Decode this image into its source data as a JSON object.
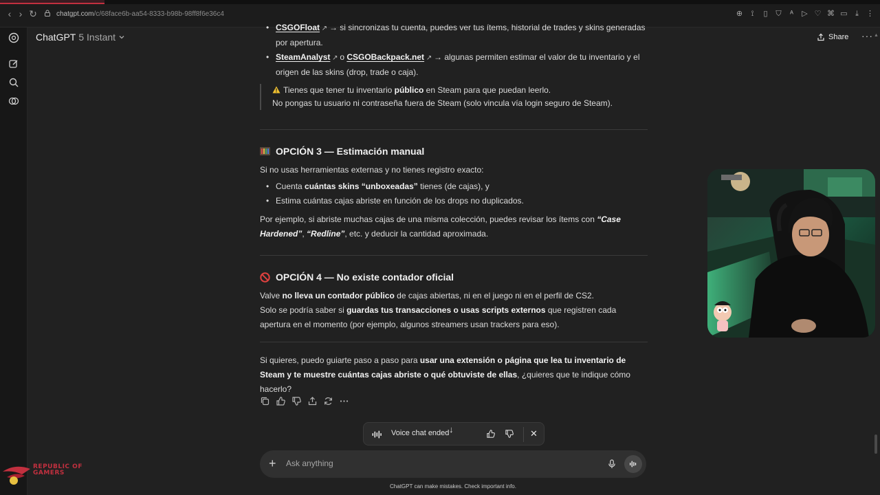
{
  "browser": {
    "url_host": "chatgpt.com",
    "url_path": "/c/68face6b-aa54-8333-b98b-98ff8f6e36c4"
  },
  "header": {
    "model_name": "ChatGPT",
    "model_variant": "5 Instant",
    "share_label": "Share",
    "more_label": "···"
  },
  "message": {
    "tool_list": [
      {
        "link": "CSGOFloat",
        "text": "→ si sincronizas tu cuenta, puedes ver tus ítems, historial de trades y skins generadas por apertura."
      },
      {
        "link": "SteamAnalyst",
        "middle": "o",
        "link2": "CSGOBackpack.net",
        "text": "→ algunas permiten estimar el valor de tu inventario y el origen de las skins (drop, trade o caja)."
      }
    ],
    "quote": {
      "line1_pre": "Tienes que tener tu inventario ",
      "line1_bold": "público",
      "line1_post": " en Steam para que puedan leerlo.",
      "line2": "No pongas tu usuario ni contraseña fuera de Steam (solo vincula vía login seguro de Steam)."
    },
    "option3": {
      "title": "OPCIÓN 3 — Estimación manual",
      "intro": "Si no usas herramientas externas y no tienes registro exacto:",
      "bullet1_pre": "Cuenta ",
      "bullet1_bold": "cuántas skins “unboxeadas”",
      "bullet1_post": " tienes (de cajas), y",
      "bullet2": "Estima cuántas cajas abriste en función de los drops no duplicados.",
      "example_pre": "Por ejemplo, si abriste muchas cajas de una misma colección, puedes revisar los ítems con ",
      "example_i1": "“Case Hardened”",
      "example_mid": ", ",
      "example_i2": "“Redline”",
      "example_post": ", etc. y deducir la cantidad aproximada."
    },
    "option4": {
      "title": "OPCIÓN 4 — No existe contador oficial",
      "p1_pre": "Valve ",
      "p1_bold": "no lleva un contador público",
      "p1_post": " de cajas abiertas, ni en el juego ni en el perfil de CS2.",
      "p2_pre": "Solo se podría saber si ",
      "p2_bold": "guardas tus transacciones o usas scripts externos",
      "p2_post": " que registren cada apertura en el momento (por ejemplo, algunos streamers usan trackers para eso)."
    },
    "closing": {
      "pre": "Si quieres, puedo guiarte paso a paso para ",
      "bold": "usar una extensión o página que lea tu inventario de Steam y te muestre cuántas cajas abriste o qué obtuviste de ellas",
      "post": ", ¿quieres que te indique cómo hacerlo?"
    }
  },
  "voice_pill": {
    "label": "Voice chat ended"
  },
  "composer": {
    "placeholder": "Ask anything"
  },
  "footer": {
    "note": "ChatGPT can make mistakes. Check important info."
  },
  "overlay": {
    "rog_text_line1": "REPUBLIC OF",
    "rog_text_line2": "GAMERS"
  },
  "colors": {
    "background": "#212121",
    "composer": "#303030",
    "rail": "#171717",
    "accent_red": "#c2303f"
  }
}
